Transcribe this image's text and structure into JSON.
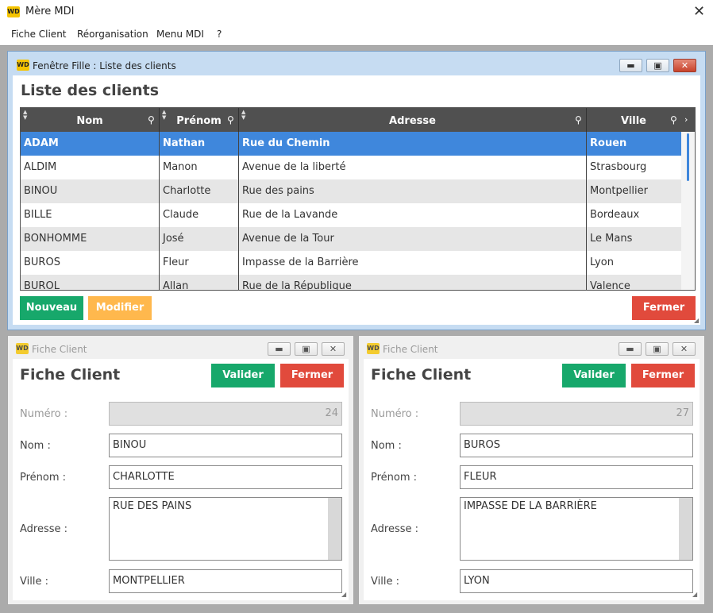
{
  "app": {
    "title": "Mère MDI",
    "close_glyph": "✕",
    "logo_text": "WD"
  },
  "menu": {
    "items": [
      "Fiche Client",
      "Réorganisation",
      "Menu MDI",
      "?"
    ]
  },
  "list_window": {
    "title": "Fenêtre Fille : Liste des clients",
    "heading": "Liste des clients",
    "columns": [
      "Nom",
      "Prénom",
      "Adresse",
      "Ville"
    ],
    "rows": [
      {
        "nom": "ADAM",
        "prenom": "Nathan",
        "adresse": "Rue du Chemin",
        "ville": "Rouen"
      },
      {
        "nom": "ALDIM",
        "prenom": "Manon",
        "adresse": "Avenue de la liberté",
        "ville": "Strasbourg"
      },
      {
        "nom": "BINOU",
        "prenom": "Charlotte",
        "adresse": "Rue des pains",
        "ville": "Montpellier"
      },
      {
        "nom": "BILLE",
        "prenom": "Claude",
        "adresse": "Rue de la Lavande",
        "ville": "Bordeaux"
      },
      {
        "nom": "BONHOMME",
        "prenom": "José",
        "adresse": "Avenue de la Tour",
        "ville": "Le Mans"
      },
      {
        "nom": "BUROS",
        "prenom": "Fleur",
        "adresse": "Impasse de la Barrière",
        "ville": "Lyon"
      },
      {
        "nom": "BUROL",
        "prenom": "Allan",
        "adresse": "Rue de la République",
        "ville": "Valence"
      }
    ],
    "buttons": {
      "new": "Nouveau",
      "edit": "Modifier",
      "close": "Fermer"
    }
  },
  "fiche_left": {
    "title": "Fiche Client",
    "heading": "Fiche Client",
    "valider": "Valider",
    "fermer": "Fermer",
    "labels": {
      "numero": "Numéro :",
      "nom": "Nom :",
      "prenom": "Prénom :",
      "adresse": "Adresse :",
      "ville": "Ville :"
    },
    "values": {
      "numero": "24",
      "nom": "BINOU",
      "prenom": "CHARLOTTE",
      "adresse": "RUE DES PAINS",
      "ville": "MONTPELLIER"
    }
  },
  "fiche_right": {
    "title": "Fiche Client",
    "heading": "Fiche Client",
    "valider": "Valider",
    "fermer": "Fermer",
    "labels": {
      "numero": "Numéro :",
      "nom": "Nom :",
      "prenom": "Prénom :",
      "adresse": "Adresse :",
      "ville": "Ville :"
    },
    "values": {
      "numero": "27",
      "nom": "BUROS",
      "prenom": "FLEUR",
      "adresse": "IMPASSE DE LA BARRIÈRE",
      "ville": "LYON"
    }
  },
  "colors": {
    "selected_row": "#3f87dc",
    "green": "#17a86b",
    "orange": "#ffb84d",
    "red": "#e14a3c",
    "header": "#505050"
  }
}
